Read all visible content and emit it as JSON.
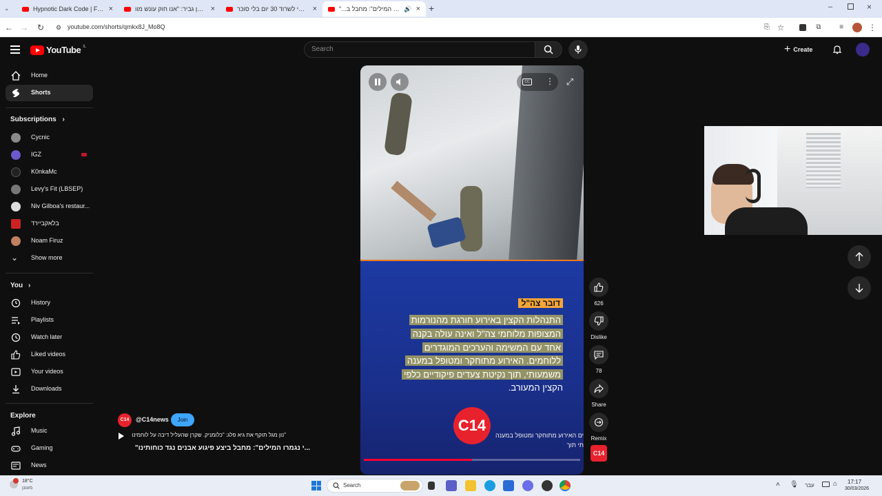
{
  "browser": {
    "tabs": [
      {
        "label": "Hypnotic Dark Code | Futuristi"
      },
      {
        "label": "השר בן גביר: \"אנו חוק עונש מוו"
      },
      {
        "label": "נסיתי לשרוד 30 יום בלי סוכר"
      },
      {
        "label": "\"...י נגמרו המילים\": מחבל ב"
      }
    ],
    "url": "youtube.com/shorts/qmkx8J_Mo8Q"
  },
  "youtube": {
    "logo_text": "YouTube",
    "region": "IL",
    "search_placeholder": "Search",
    "create_label": "Create"
  },
  "sidebar": {
    "home": "Home",
    "shorts": "Shorts",
    "subscriptions_heading": "Subscriptions",
    "subscriptions": [
      {
        "label": "Cycnic",
        "color": "#8a8a8a"
      },
      {
        "label": "IGZ",
        "color": "#6a5acd"
      },
      {
        "label": "K0nkaMc",
        "color": "#222222"
      },
      {
        "label": "Levy's Fit (LBSEP)",
        "color": "#777777"
      },
      {
        "label": "Niv Gilboa's restaur...",
        "color": "#dddddd"
      },
      {
        "label": "בלאקביירד",
        "color": "#cc2222"
      },
      {
        "label": "Noam Firuz",
        "color": "#c08060"
      }
    ],
    "show_more": "Show more",
    "you_heading": "You",
    "you_items": [
      "History",
      "Playlists",
      "Watch later",
      "Liked videos",
      "Your videos",
      "Downloads"
    ],
    "explore_heading": "Explore",
    "explore_items": [
      "Music",
      "Gaming",
      "News"
    ]
  },
  "short": {
    "caption_tag": "דובר צה\"ל",
    "caption_lines": [
      "התנהלות הקצין באירוע חורגת מהנורמות",
      "המצופות מלוחמי צה\"ל ואינה עולה בקנה",
      "אחד עם המשימה והערכים המוגדרים",
      "ללוחמים. האירוע מתוחקר ומטופל במענה",
      "משמעותי, תוך נקיטת צעדים פיקודיים כלפי",
      "הקצין המעורב."
    ],
    "ticker_line1": "ים האירוע מתוחקר ומטופל במענה",
    "ticker_line2": "תי תוך",
    "logo": "C14",
    "channel_handle": "@C14news",
    "join_label": "Join",
    "music_line": "\"נון מגל תוקף את גיא פלג: \"כלומניק. שקרן שהעליל דיבה על לוחמינו",
    "title": "...י נגמרו המילים\": מחבל ביצע פיגוע אבנים נגד כוחותינו\"",
    "progress": 0.5
  },
  "rail": {
    "like_count": "626",
    "dislike_label": "Dislike",
    "comments_count": "78",
    "share_label": "Share",
    "remix_label": "Remix"
  },
  "taskbar": {
    "weather_temp": "18°C",
    "weather_desc": "מעונן",
    "search_label": "Search",
    "lang": "עבר",
    "time": "17:17",
    "date": "30/03/2026"
  }
}
